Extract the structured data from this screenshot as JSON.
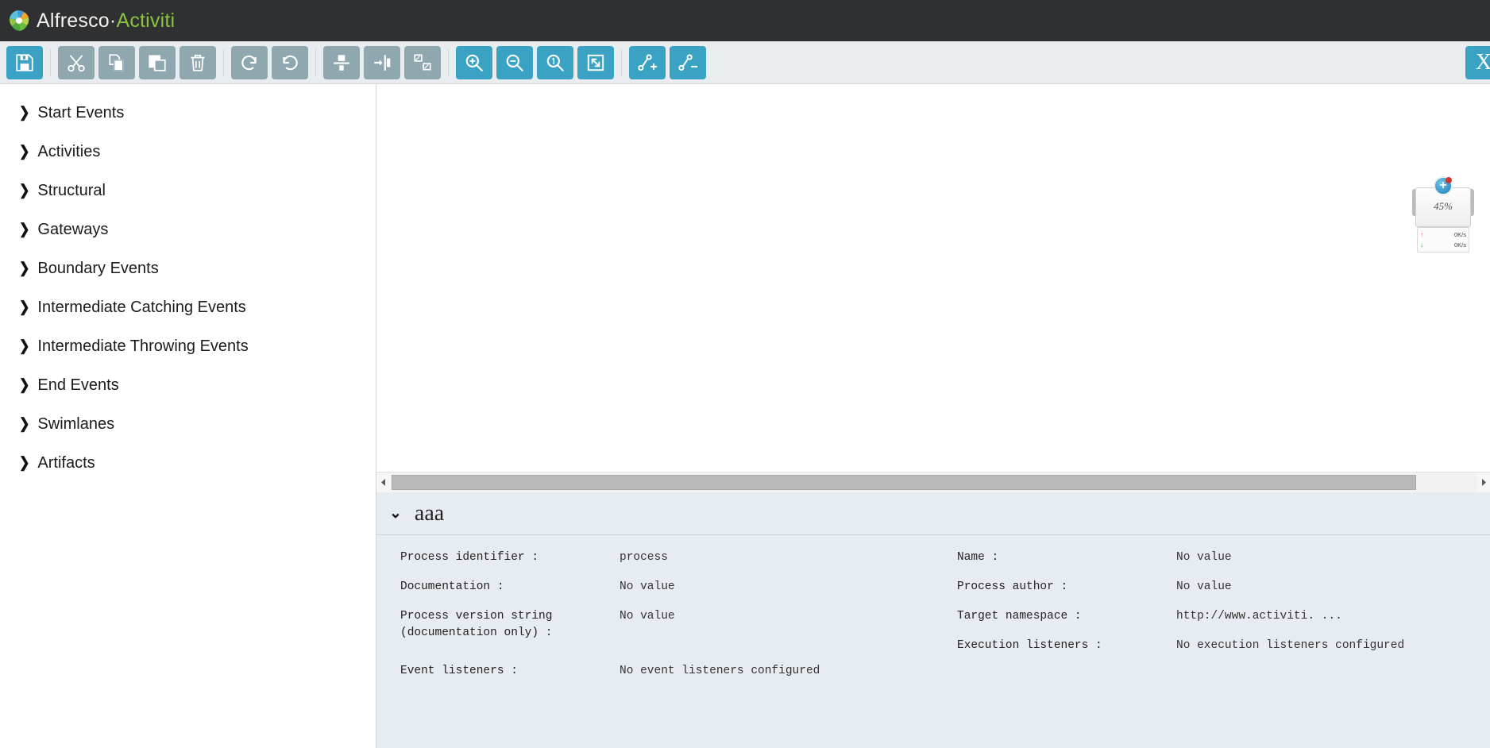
{
  "brand": {
    "name_primary": "Alfresco",
    "name_separator": "·",
    "name_secondary": "Activiti",
    "logo_icon": "alfresco-pinwheel-icon",
    "bar_color": "#2e3032",
    "accent_green": "#8bc33f"
  },
  "toolbar": {
    "background": "#e9edef",
    "inactive_color": "#8fa7ae",
    "active_color": "#3aa3c4",
    "buttons": [
      {
        "name": "save-button",
        "icon": "floppy-disk-icon",
        "state": "active",
        "label": "Save"
      },
      {
        "name": "cut-button",
        "icon": "scissors-icon",
        "state": "inactive",
        "label": "Cut"
      },
      {
        "name": "copy-button",
        "icon": "copy-icon",
        "state": "inactive",
        "label": "Copy"
      },
      {
        "name": "paste-button",
        "icon": "paste-icon",
        "state": "inactive",
        "label": "Paste"
      },
      {
        "name": "delete-button",
        "icon": "trash-icon",
        "state": "inactive",
        "label": "Delete"
      },
      {
        "name": "redo-button",
        "icon": "redo-arrow-icon",
        "state": "inactive",
        "label": "Redo"
      },
      {
        "name": "undo-button",
        "icon": "undo-arrow-icon",
        "state": "inactive",
        "label": "Undo"
      },
      {
        "name": "align-vertical-button",
        "icon": "align-vertical-icon",
        "state": "inactive",
        "label": "Align vertical"
      },
      {
        "name": "align-horizontal-button",
        "icon": "align-horizontal-icon",
        "state": "inactive",
        "label": "Align horizontal"
      },
      {
        "name": "same-size-button",
        "icon": "same-size-icon",
        "state": "inactive",
        "label": "Same size"
      },
      {
        "name": "zoom-in-button",
        "icon": "zoom-in-icon",
        "state": "active",
        "label": "Zoom in"
      },
      {
        "name": "zoom-out-button",
        "icon": "zoom-out-icon",
        "state": "active",
        "label": "Zoom out"
      },
      {
        "name": "zoom-actual-button",
        "icon": "zoom-actual-icon",
        "state": "active",
        "label": "Zoom actual"
      },
      {
        "name": "zoom-fit-button",
        "icon": "zoom-fit-icon",
        "state": "active",
        "label": "Zoom fit"
      },
      {
        "name": "add-bendpoint-button",
        "icon": "bendpoint-add-icon",
        "state": "active",
        "label": "Add bendpoint"
      },
      {
        "name": "remove-bendpoint-button",
        "icon": "bendpoint-remove-icon",
        "state": "active",
        "label": "Remove bendpoint"
      }
    ],
    "close_label": "X"
  },
  "palette": {
    "items": [
      {
        "label": "Start Events"
      },
      {
        "label": "Activities"
      },
      {
        "label": "Structural"
      },
      {
        "label": "Gateways"
      },
      {
        "label": "Boundary Events"
      },
      {
        "label": "Intermediate Catching Events"
      },
      {
        "label": "Intermediate Throwing Events"
      },
      {
        "label": "End Events"
      },
      {
        "label": "Swimlanes"
      },
      {
        "label": "Artifacts"
      }
    ],
    "chevron_glyph": "❯"
  },
  "canvas": {
    "scrollbar": {
      "left_arrow_glyph": "◀",
      "right_arrow_glyph": "▶"
    }
  },
  "properties": {
    "title": "aaa",
    "chevron_glyph": "⌄",
    "left": [
      {
        "key": "Process identifier  :",
        "value": "process"
      },
      {
        "key": "Documentation  :",
        "value": "No value"
      },
      {
        "key": "Process version string (documentation only)  :",
        "value": "No value"
      },
      {
        "key": "Event listeners  :",
        "value": "No event listeners configured"
      }
    ],
    "right": [
      {
        "key": "Name  :",
        "value": "No value"
      },
      {
        "key": "Process author  :",
        "value": "No value"
      },
      {
        "key": "Target namespace  :",
        "value": "http://www.activiti. ..."
      },
      {
        "key": "Execution listeners  :",
        "value": "No execution listeners configured"
      }
    ]
  },
  "desktop_widget": {
    "cpu_percent": "45%",
    "upload_rate": "0K/s",
    "download_rate": "0K/s",
    "upload_glyph": "↑",
    "download_glyph": "↓",
    "badge_glyph": "+"
  }
}
